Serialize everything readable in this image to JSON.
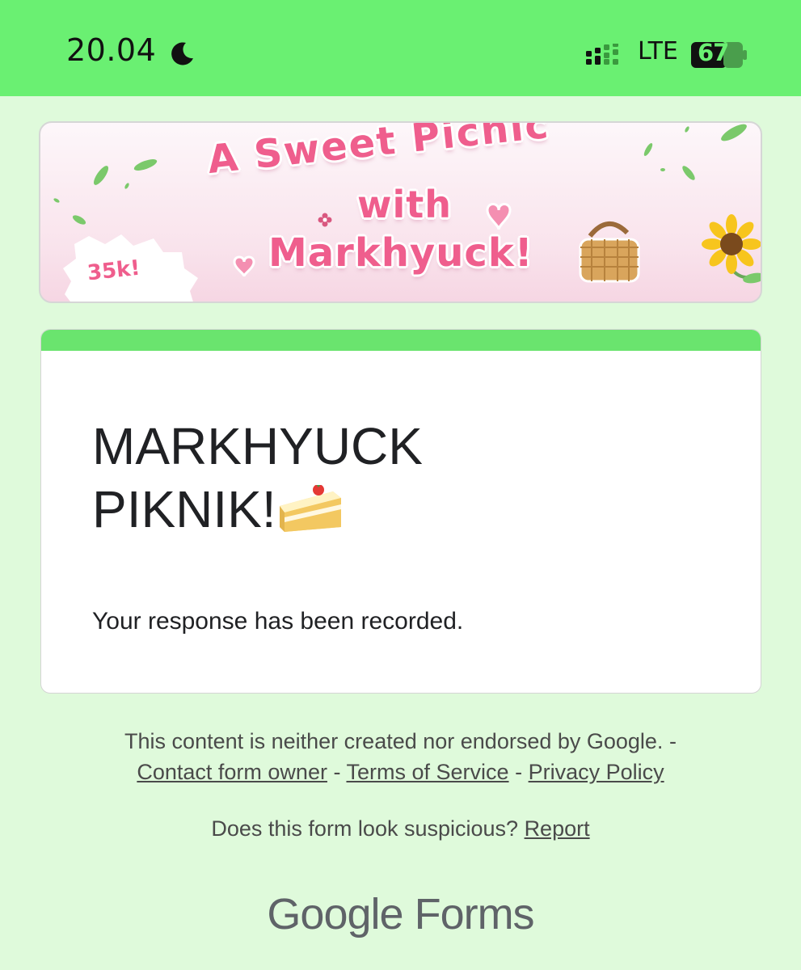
{
  "status_bar": {
    "time": "20.04",
    "network": "LTE",
    "battery": "67",
    "icons": [
      "moon-icon",
      "signal-icon",
      "battery-icon"
    ]
  },
  "banner": {
    "line1": "A Sweet Picnic",
    "line2": "with",
    "line3": "Markhyuck!",
    "badge": "35k!"
  },
  "form": {
    "title_line1": "MARKHYUCK",
    "title_line2": "PIKNIK!",
    "title_icon": "cake-icon",
    "message": "Your response has been recorded.",
    "accent_color": "#6ae46e"
  },
  "footer": {
    "disclaimer": "This content is neither created nor endorsed by Google. -",
    "sep": "-",
    "contact": "Contact form owner",
    "terms": "Terms of Service",
    "privacy": "Privacy Policy",
    "suspicious": "Does this form look suspicious?",
    "report": "Report",
    "brand_google": "Google",
    "brand_forms": "Forms"
  },
  "colors": {
    "status_bar": "#6af072",
    "page_background": "#dffadb",
    "banner_text": "#ef5e8d"
  }
}
